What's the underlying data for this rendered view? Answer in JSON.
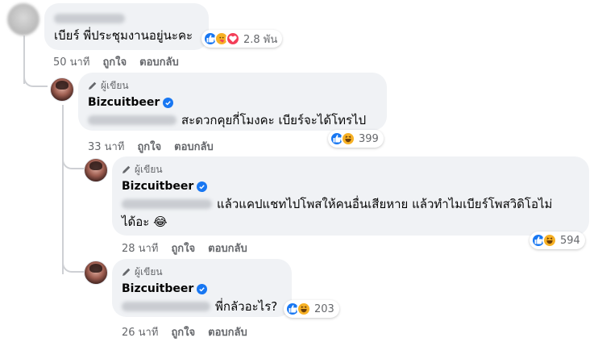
{
  "comment": {
    "text": "เบียร์ พี่ประชุมงานอยู่นะคะ",
    "reactions": {
      "icons": [
        "like-icon",
        "care-icon",
        "love-icon"
      ],
      "count": "2.8 พัน"
    },
    "time": "50 นาที",
    "like_label": "ถูกใจ",
    "reply_label": "ตอบกลับ"
  },
  "replies": [
    {
      "author_badge": "ผู้เขียน",
      "author_name": "Bizcuitbeer",
      "text": "สะดวกคุยกี่โมงคะ เบียร์จะได้โทรไป",
      "reactions": {
        "icons": [
          "like-icon",
          "haha-icon"
        ],
        "count": "399"
      },
      "time": "33 นาที",
      "like_label": "ถูกใจ",
      "reply_label": "ตอบกลับ"
    },
    {
      "author_badge": "ผู้เขียน",
      "author_name": "Bizcuitbeer",
      "text_line1": "แล้วแคปแชทไปโพสให้คนอื่นเสียหาย แล้วทำไมเบียร์โพสวิดิโอไม่",
      "text_line2": "ได้อะ 😂",
      "reactions": {
        "icons": [
          "like-icon",
          "haha-icon"
        ],
        "count": "594"
      },
      "time": "28 นาที",
      "like_label": "ถูกใจ",
      "reply_label": "ตอบกลับ"
    },
    {
      "author_badge": "ผู้เขียน",
      "author_name": "Bizcuitbeer",
      "text": "พี่กลัวอะไร?",
      "reactions": {
        "icons": [
          "like-icon",
          "haha-icon"
        ],
        "count": "203"
      },
      "time": "26 นาที",
      "like_label": "ถูกใจ",
      "reply_label": "ตอบกลับ"
    }
  ],
  "colors": {
    "bubble": "#f0f2f5",
    "meta_text": "#65676b",
    "like": "#1877f2",
    "haha": "#f7b125",
    "love": "#f33e58",
    "thread_line": "#ced0d4"
  }
}
